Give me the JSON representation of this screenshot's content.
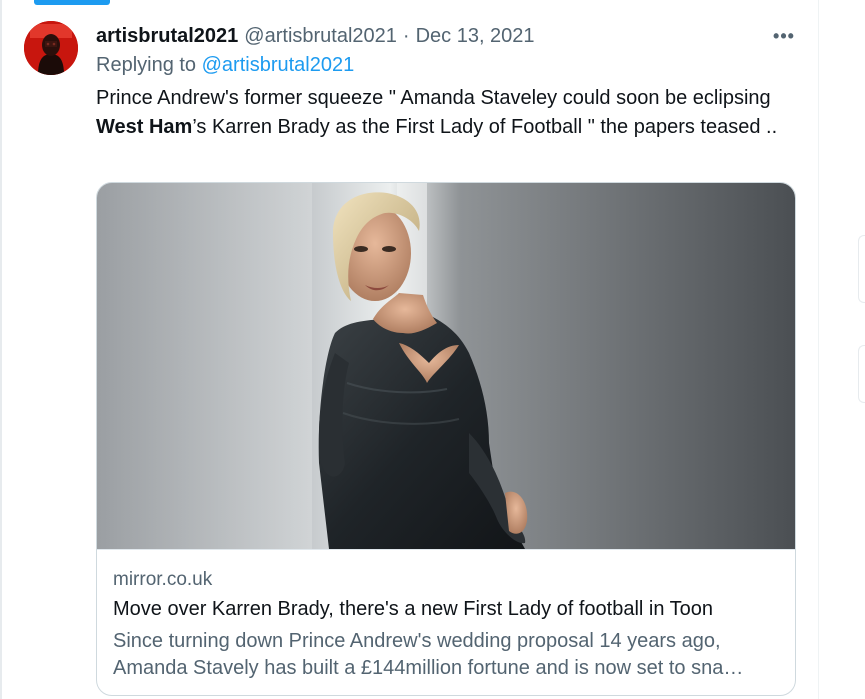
{
  "tweet": {
    "username": "artisbrutal2021",
    "handle": "@artisbrutal2021",
    "separator": "·",
    "date": "Dec 13, 2021",
    "more_icon": "more-horizontal-icon",
    "more_label": "•••",
    "reply_prefix": "Replying to",
    "reply_to": "@artisbrutal2021",
    "text": {
      "part1": "Prince Andrew's former squeeze \" Amanda Staveley could soon be eclipsing ",
      "bold": "West Ham",
      "part2": "’s Karren Brady as the First Lady of Football \" the papers teased .."
    }
  },
  "card": {
    "domain": "mirror.co.uk",
    "title": "Move over Karren Brady, there's a new First Lady of football in Toon",
    "description_line1": "Since turning down Prince Andrew's wedding proposal 14 years ago,",
    "description_line2": "Amanda Stavely has built a £144million fortune and is now set to sna…"
  },
  "colors": {
    "accent": "#1d9bf0",
    "text_primary": "#0f1419",
    "text_secondary": "#536471",
    "border": "#cfd9de"
  }
}
